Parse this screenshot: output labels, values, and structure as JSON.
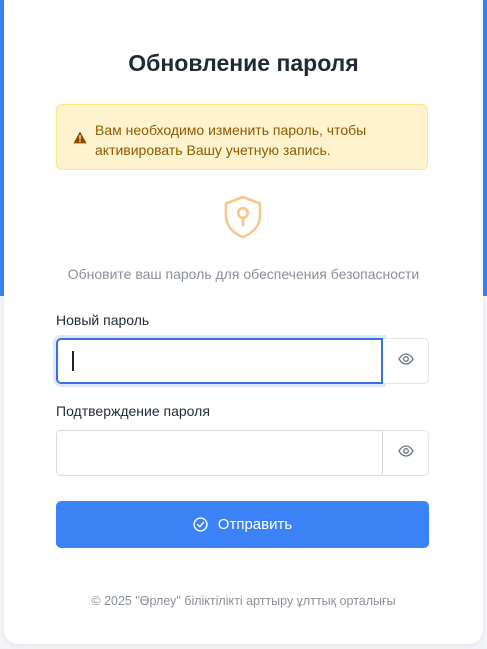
{
  "page": {
    "title": "Обновление пароля",
    "alert_text": "Вам необходимо изменить пароль, чтобы активировать Вашу учетную запись.",
    "subtitle": "Обновите ваш пароль для обеспечения безопасности"
  },
  "form": {
    "new_password_label": "Новый пароль",
    "new_password_value": "",
    "confirm_password_label": "Подтверждение пароля",
    "confirm_password_value": "",
    "submit_label": "Отправить"
  },
  "footer": {
    "text": "© 2025 \"Өрлеу\" біліктілікті арттыру ұлттық орталығы"
  },
  "icons": {
    "alert": "warning-triangle-icon",
    "shield": "shield-keyhole-icon",
    "eye": "eye-icon",
    "submit": "check-circle-icon"
  },
  "colors": {
    "accent": "#3b82f6",
    "alert_bg": "#fff3cd",
    "alert_text": "#8a5a00",
    "shield": "#f2c98a"
  }
}
